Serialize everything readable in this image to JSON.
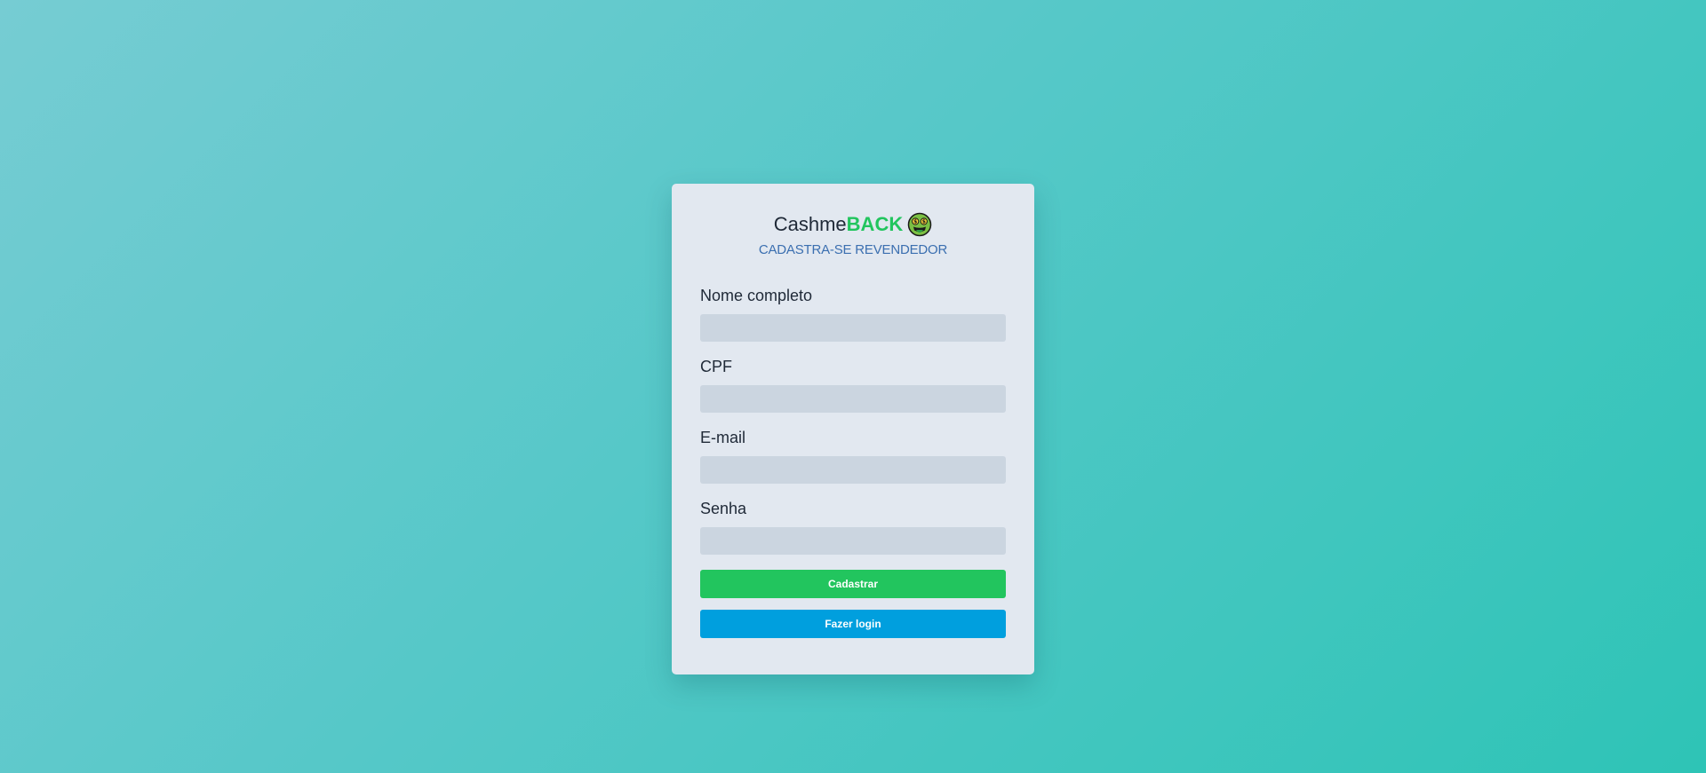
{
  "brand": {
    "name_prefix": "Cashme",
    "name_suffix": "BACK",
    "icon": "money-mouth-face-icon",
    "subtitle": "CADASTRA-SE REVENDEDOR"
  },
  "form": {
    "fields": [
      {
        "label": "Nome completo",
        "value": "",
        "placeholder": ""
      },
      {
        "label": "CPF",
        "value": "",
        "placeholder": ""
      },
      {
        "label": "E-mail",
        "value": "",
        "placeholder": ""
      },
      {
        "label": "Senha",
        "value": "",
        "placeholder": ""
      }
    ],
    "submit_label": "Cadastrar",
    "login_label": "Fazer login"
  },
  "colors": {
    "accent_green": "#22c55e",
    "accent_blue": "#009fde",
    "subtitle_blue": "#3b6fb0",
    "card_bg": "#e2e8f0",
    "input_bg": "#cbd5e0"
  }
}
